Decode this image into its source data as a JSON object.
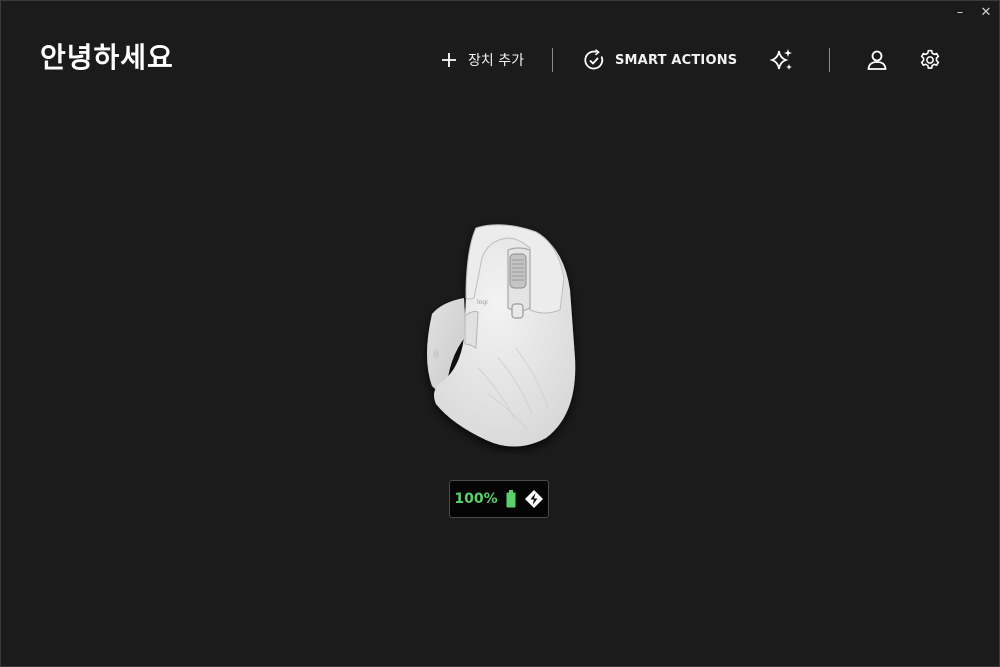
{
  "header": {
    "greeting": "안녕하세요"
  },
  "toolbar": {
    "add_device_label": "장치 추가",
    "smart_actions_label": "SMART ACTIONS",
    "icons": {
      "add": "plus-icon",
      "smart_actions": "check-circle-arrow-icon",
      "ai": "sparkle-icon",
      "profile": "user-icon",
      "settings": "gear-icon"
    }
  },
  "window_controls": {
    "minimize": "–",
    "close": "✕"
  },
  "device": {
    "icon": "mouse-icon",
    "battery_percent": "100%",
    "battery_level": 1.0,
    "battery_color": "#5ad06a",
    "connection_icon": "logi-bolt-icon"
  },
  "colors": {
    "background": "#1b1b1b",
    "text": "#ffffff",
    "accent_green": "#5ad06a"
  }
}
